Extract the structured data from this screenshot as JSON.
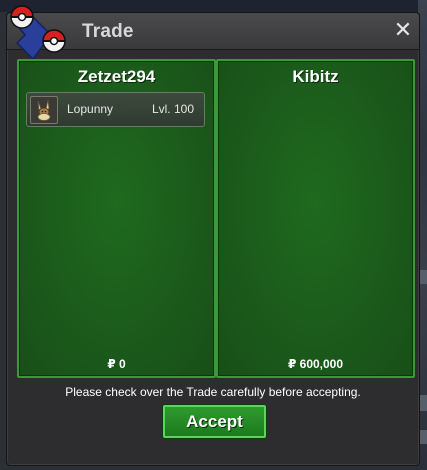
{
  "window": {
    "title": "Trade",
    "close_glyph": "✕"
  },
  "panels": [
    {
      "player": "Zetzet294",
      "pokemon": [
        {
          "name": "Lopunny",
          "level": "Lvl. 100",
          "icon": "lopunny-sprite-icon"
        }
      ],
      "money": "₽ 0"
    },
    {
      "player": "Kibitz",
      "pokemon": [],
      "money": "₽ 600,000"
    }
  ],
  "footer": {
    "notice": "Please check over the Trade carefully before accepting.",
    "accept_label": "Accept"
  },
  "colors": {
    "panel_green": "#1c5d1c",
    "panel_border": "#3a9a3a",
    "accept_green": "#2f9a2f",
    "window_bg": "#2d2d2f"
  }
}
